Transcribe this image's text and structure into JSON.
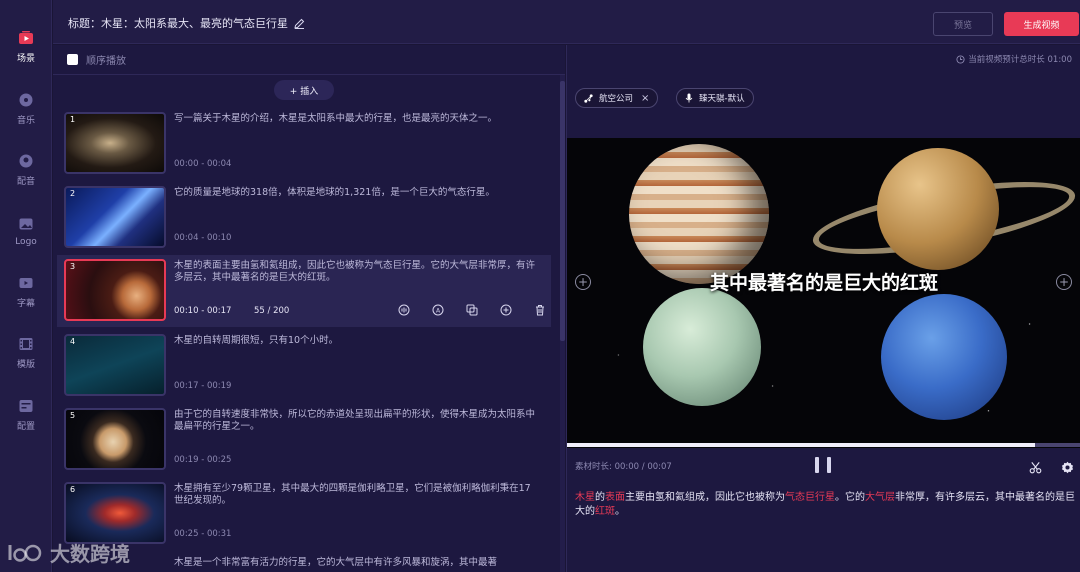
{
  "sidebar": {
    "items": [
      {
        "label": "场景",
        "icon": "play-screen-icon",
        "active": true
      },
      {
        "label": "音乐",
        "icon": "music-disc-icon",
        "active": false
      },
      {
        "label": "配音",
        "icon": "dub-face-icon",
        "active": false
      },
      {
        "label": "Logo",
        "icon": "image-icon",
        "active": false
      },
      {
        "label": "字幕",
        "icon": "subtitle-icon",
        "active": false
      },
      {
        "label": "模版",
        "icon": "film-template-icon",
        "active": false
      },
      {
        "label": "配置",
        "icon": "settings-panel-icon",
        "active": false
      }
    ]
  },
  "header": {
    "title": "标题：木星：太阳系最大、最亮的气态巨行星",
    "preview_label": "预览",
    "generate_label": "生成视频"
  },
  "scene_panel": {
    "sequential_label": "顺序播放",
    "sequential_checked": false,
    "insert_label": "+ 插入",
    "scenes": [
      {
        "num": "1",
        "text": "写一篇关于木星的介绍，木星是太阳系中最大的行星，也是最亮的天体之一。",
        "time": "00:00 - 00:04"
      },
      {
        "num": "2",
        "text": "它的质量是地球的318倍，体积是地球的1,321倍，是一个巨大的气态行星。",
        "time": "00:04 - 00:10"
      },
      {
        "num": "3",
        "text": "木星的表面主要由氢和氦组成，因此它也被称为气态巨行星。它的大气层非常厚，有许多层云，其中最著名的是巨大的红斑。",
        "time": "00:10 - 00:17",
        "count": "55 / 200",
        "active": true
      },
      {
        "num": "4",
        "text": "木星的自转周期很短，只有10个小时。",
        "time": "00:17 - 00:19"
      },
      {
        "num": "5",
        "text": "由于它的自转速度非常快，所以它的赤道处呈现出扁平的形状，使得木星成为太阳系中最扁平的行星之一。",
        "time": "00:19 - 00:25"
      },
      {
        "num": "6",
        "text": "木星拥有至少79颗卫星，其中最大的四颗是伽利略卫星，它们是被伽利略伽利秉在17世纪发现的。",
        "time": "00:25 - 00:31"
      },
      {
        "num": "7",
        "text": "木星是一个非常富有活力的行星，它的大气层中有许多风暴和旋涡，其中最著",
        "time": ""
      }
    ]
  },
  "right_panel": {
    "duration_label": "当前视频预计总时长 01:00",
    "chips": [
      {
        "label": "航空公司",
        "icon": "share-node-icon",
        "closable": true
      },
      {
        "label": "臻天骐-默认",
        "icon": "microphone-icon",
        "closable": false
      }
    ],
    "preview_subtitle": "其中最著名的是巨大的红斑",
    "progress": 0.91,
    "material_time": "素材时长: 00:00 / 00:07",
    "caption_segments": [
      {
        "text": "木星",
        "hl": true
      },
      {
        "text": "的",
        "hl": false
      },
      {
        "text": "表面",
        "hl": true
      },
      {
        "text": "主要由氢和氦组成，因此它也被称为",
        "hl": false
      },
      {
        "text": "气态巨行星",
        "hl": true
      },
      {
        "text": "。它的",
        "hl": false
      },
      {
        "text": "大气层",
        "hl": true
      },
      {
        "text": "非常厚，有许多层云，其中最著名的是巨大的",
        "hl": false
      },
      {
        "text": "红斑",
        "hl": true
      },
      {
        "text": "。",
        "hl": false
      }
    ]
  },
  "watermark": {
    "text": "大数跨境"
  },
  "colors": {
    "accent": "#e83a56",
    "background": "#1a1536",
    "panel": "#1d1840"
  }
}
